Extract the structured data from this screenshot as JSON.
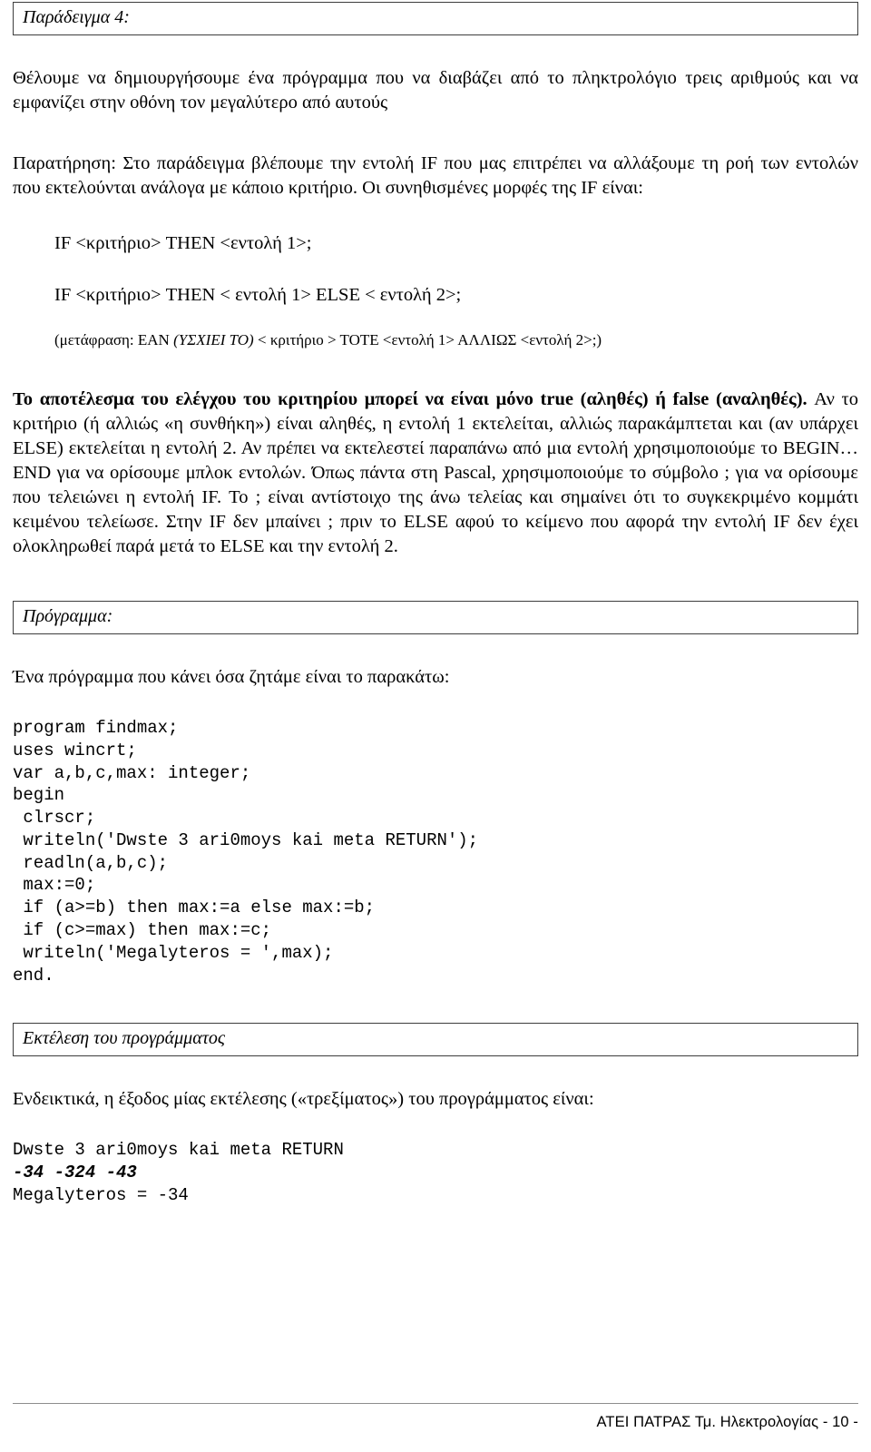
{
  "header_box": {
    "label": "Παράδειγμα 4:"
  },
  "intro": {
    "paragraph1": "Θέλουμε να δημιουργήσουμε ένα πρόγραμμα που να διαβάζει από το πληκτρολόγιο τρεις αριθμούς και να εμφανίζει στην οθόνη τον μεγαλύτερο από αυτούς",
    "paragraph2": "Παρατήρηση: Στο παράδειγμα βλέπουμε την εντολή IF που μας επιτρέπει να αλλάξουμε τη ροή των εντολών που εκτελούνται ανάλογα με κάποιο κριτήριο. Οι συνηθισμένες μορφές της IF είναι:"
  },
  "syntax": {
    "form1": "IF <κριτήριο> THEN <εντολή 1>;",
    "form2": "IF <κριτήριο> THEN < εντολή 1> ELSE < εντολή 2>;",
    "translation_prefix": "(μετάφραση: ΕΑΝ ",
    "translation_italic": "(ΥΣΧΙΕΙ ΤΟ)",
    "translation_suffix": " < κριτήριο > ΤΟΤΕ <εντολή 1> ΑΛΛΙΩΣ <εντολή 2>;)"
  },
  "explanation": {
    "bold_lead": "Το αποτέλεσμα του ελέγχου του κριτηρίου μπορεί να είναι μόνο true (αληθές) ή false (αναληθές).",
    "rest": " Αν το κριτήριο (ή αλλιώς «η συνθήκη») είναι αληθές, η εντολή 1 εκτελείται, αλλιώς παρακάμπτεται και (αν υπάρχει ELSE) εκτελείται η εντολή 2. Αν πρέπει να εκτελεστεί παραπάνω από μια εντολή χρησιμοποιούμε το BEGIN…END για να ορίσουμε μπλοκ εντολών. Όπως πάντα στη Pascal, χρησιμοποιούμε το σύμβολο ; για να ορίσουμε που τελειώνει η εντολή IF. Το ; είναι αντίστοιχο της άνω τελείας και σημαίνει ότι το συγκεκριμένο κομμάτι κειμένου τελείωσε. Στην IF δεν μπαίνει ; πριν το ELSE αφού το κείμενο που αφορά την εντολή IF δεν έχει ολοκληρωθεί παρά μετά το ELSE και την εντολή 2."
  },
  "program_section": {
    "box_label": "Πρόγραμμα:",
    "intro_line": "Ένα πρόγραμμα που κάνει όσα ζητάμε είναι το παρακάτω:",
    "code": "program findmax;\nuses wincrt;\nvar a,b,c,max: integer;\nbegin\n clrscr;\n writeln('Dwste 3 ari0moys kai meta RETURN');\n readln(a,b,c);\n max:=0;\n if (a>=b) then max:=a else max:=b;\n if (c>=max) then max:=c;\n writeln('Megalyteros = ',max);\nend."
  },
  "execution_section": {
    "box_label": "Εκτέλεση του προγράμματος",
    "intro_line": "Ενδεικτικά, η έξοδος μίας εκτέλεσης («τρεξίματος») του προγράμματος είναι:",
    "console_prompt": "Dwste 3 ari0moys kai meta RETURN",
    "console_input": "-34 -324 -43",
    "console_result": "Megalyteros = -34"
  },
  "footer": {
    "text": "ΑΤΕΙ ΠΑΤΡΑΣ Τμ. Ηλεκτρολογίας - 10 -"
  },
  "colors": {
    "text": "#000000",
    "box_border": "#3d3d3d",
    "footer_rule": "#8d8d8d",
    "page_background": "#ffffff"
  }
}
